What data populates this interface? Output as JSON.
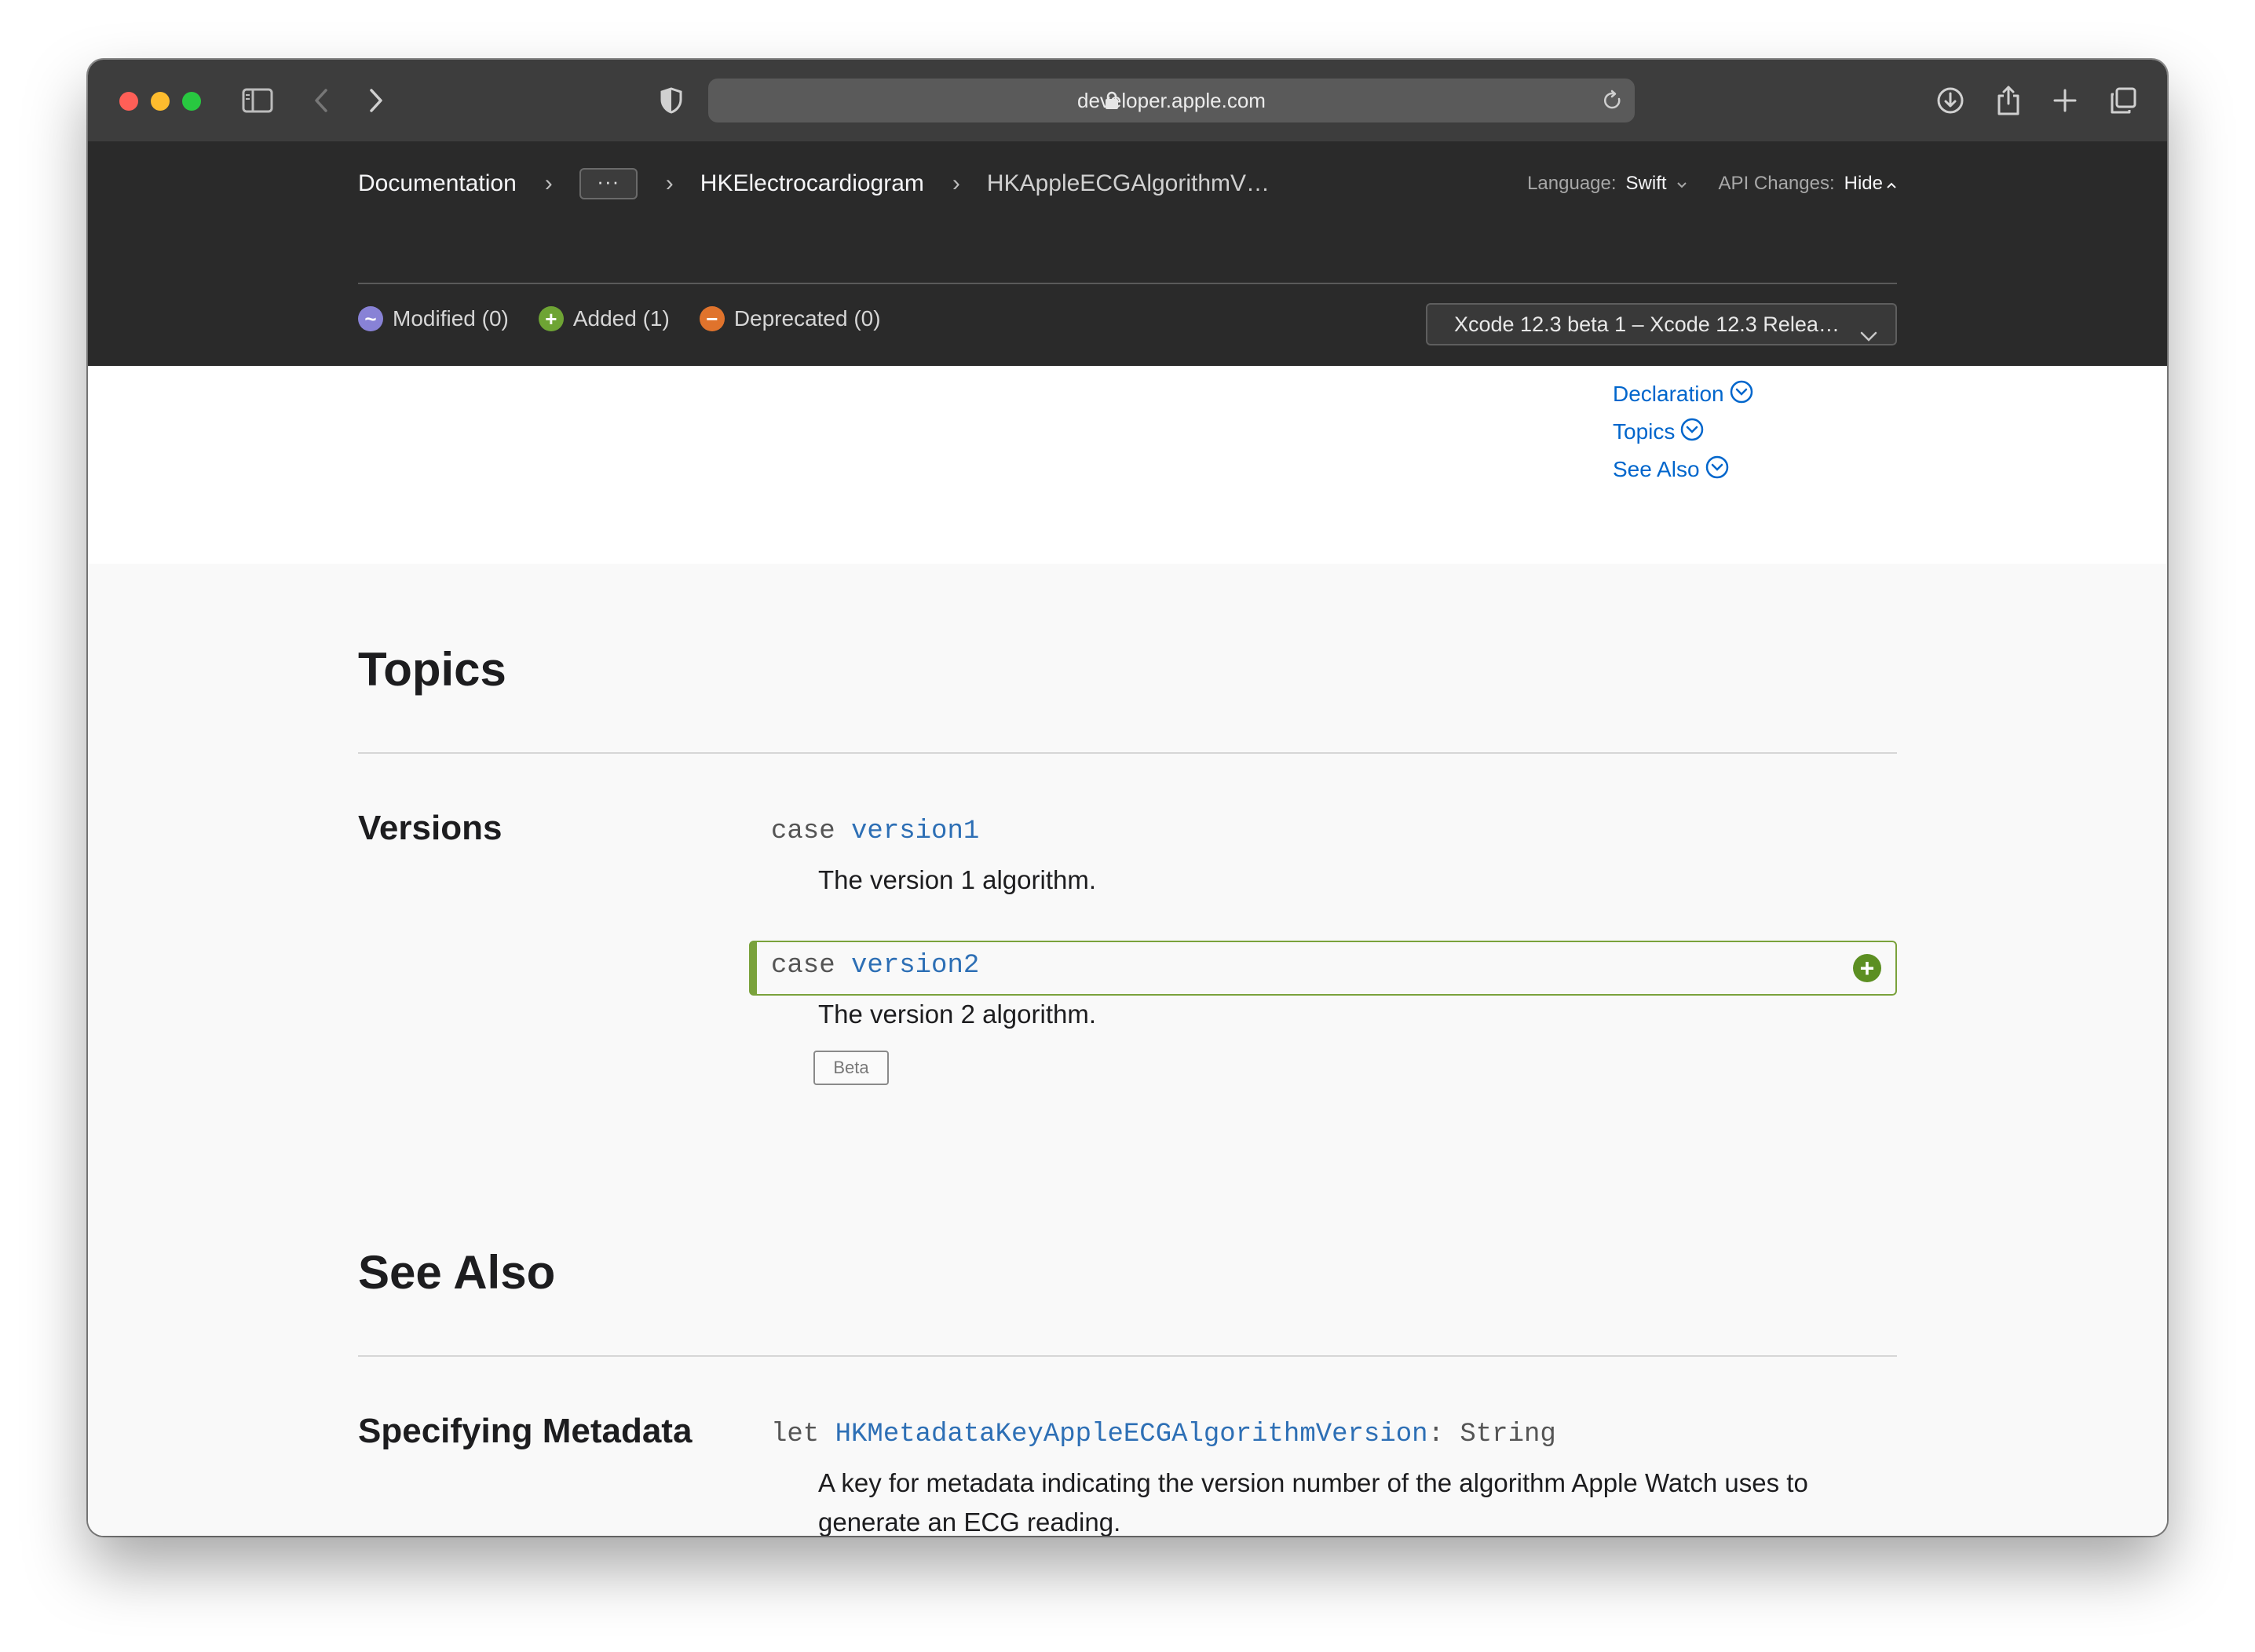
{
  "browser": {
    "url": "developer.apple.com"
  },
  "breadcrumbs": {
    "root": "Documentation",
    "more": "···",
    "parent": "HKElectrocardiogram",
    "current": "HKAppleECGAlgorithmV…"
  },
  "header": {
    "language_label": "Language:",
    "language_value": "Swift",
    "api_label": "API Changes:",
    "api_value": "Hide"
  },
  "legend": {
    "modified": "Modified (0)",
    "added": "Added (1)",
    "deprecated": "Deprecated (0)",
    "modified_symbol": "~",
    "added_symbol": "+",
    "deprecated_symbol": "−"
  },
  "version_select": {
    "value": "Xcode 12.3 beta 1 – Xcode 12.3 Relea…"
  },
  "on_this_page": [
    "Declaration",
    "Topics",
    "See Also"
  ],
  "topics": {
    "heading": "Topics",
    "group_title": "Versions",
    "items": [
      {
        "keyword": "case",
        "name": "version1",
        "abstract": "The version 1 algorithm."
      },
      {
        "keyword": "case",
        "name": "version2",
        "abstract": "The version 2 algorithm.",
        "badge": "Beta",
        "added_symbol": "+"
      }
    ]
  },
  "see_also": {
    "heading": "See Also",
    "group_title": "Specifying Metadata",
    "item": {
      "keyword": "let",
      "name": "HKMetadataKeyAppleECGAlgorithmVersion",
      "type_suffix": ": String",
      "abstract": "A key for metadata indicating the version number of the algorithm Apple Watch uses to generate an ECG reading."
    }
  },
  "colors": {
    "link": "#0066cc",
    "added": "#6ea434",
    "modified": "#8882d6",
    "deprecated": "#e0732c",
    "header_bg": "#2a2a2a"
  }
}
